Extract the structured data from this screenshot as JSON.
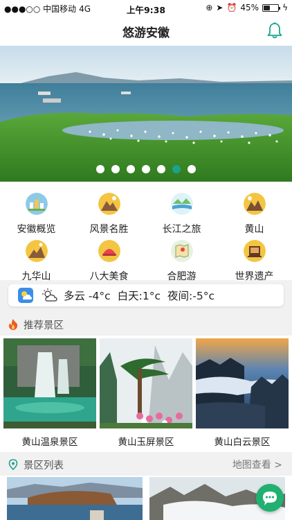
{
  "status_bar": {
    "carrier": "●●●○○ 中国移动",
    "network": "4G",
    "time": "上午9:38",
    "battery": "45%",
    "battery_level": 0.45
  },
  "header": {
    "title": "悠游安徽",
    "bell_icon": "bell-icon"
  },
  "banner": {
    "image": "lake-with-birds-photo",
    "dot_count": 7,
    "active_dot": 5
  },
  "categories": [
    {
      "label": "安徽概览",
      "icon": "city-icon"
    },
    {
      "label": "风景名胜",
      "icon": "mountain-icon"
    },
    {
      "label": "长江之旅",
      "icon": "river-icon"
    },
    {
      "label": "黄山",
      "icon": "mountain-icon"
    },
    {
      "label": "九华山",
      "icon": "mountain-icon"
    },
    {
      "label": "八大美食",
      "icon": "food-icon"
    },
    {
      "label": "合肥游",
      "icon": "map-icon"
    },
    {
      "label": "世界遗产",
      "icon": "heritage-icon"
    }
  ],
  "weather": {
    "condition": "多云 -4°c",
    "day": "白天:1°c",
    "night": "夜间:-5°c"
  },
  "recommended": {
    "title": "推荐景区",
    "items": [
      {
        "name": "黄山温泉景区",
        "image": "waterfall-photo"
      },
      {
        "name": "黄山玉屏景区",
        "image": "pine-tree-photo"
      },
      {
        "name": "黄山白云景区",
        "image": "sea-of-clouds-photo"
      }
    ]
  },
  "scenic_list": {
    "title": "景区列表",
    "map_link": "地图查看 >"
  },
  "colors": {
    "accent": "#1aa38c",
    "fire": "#ee5a24",
    "chat": "#21b070"
  }
}
